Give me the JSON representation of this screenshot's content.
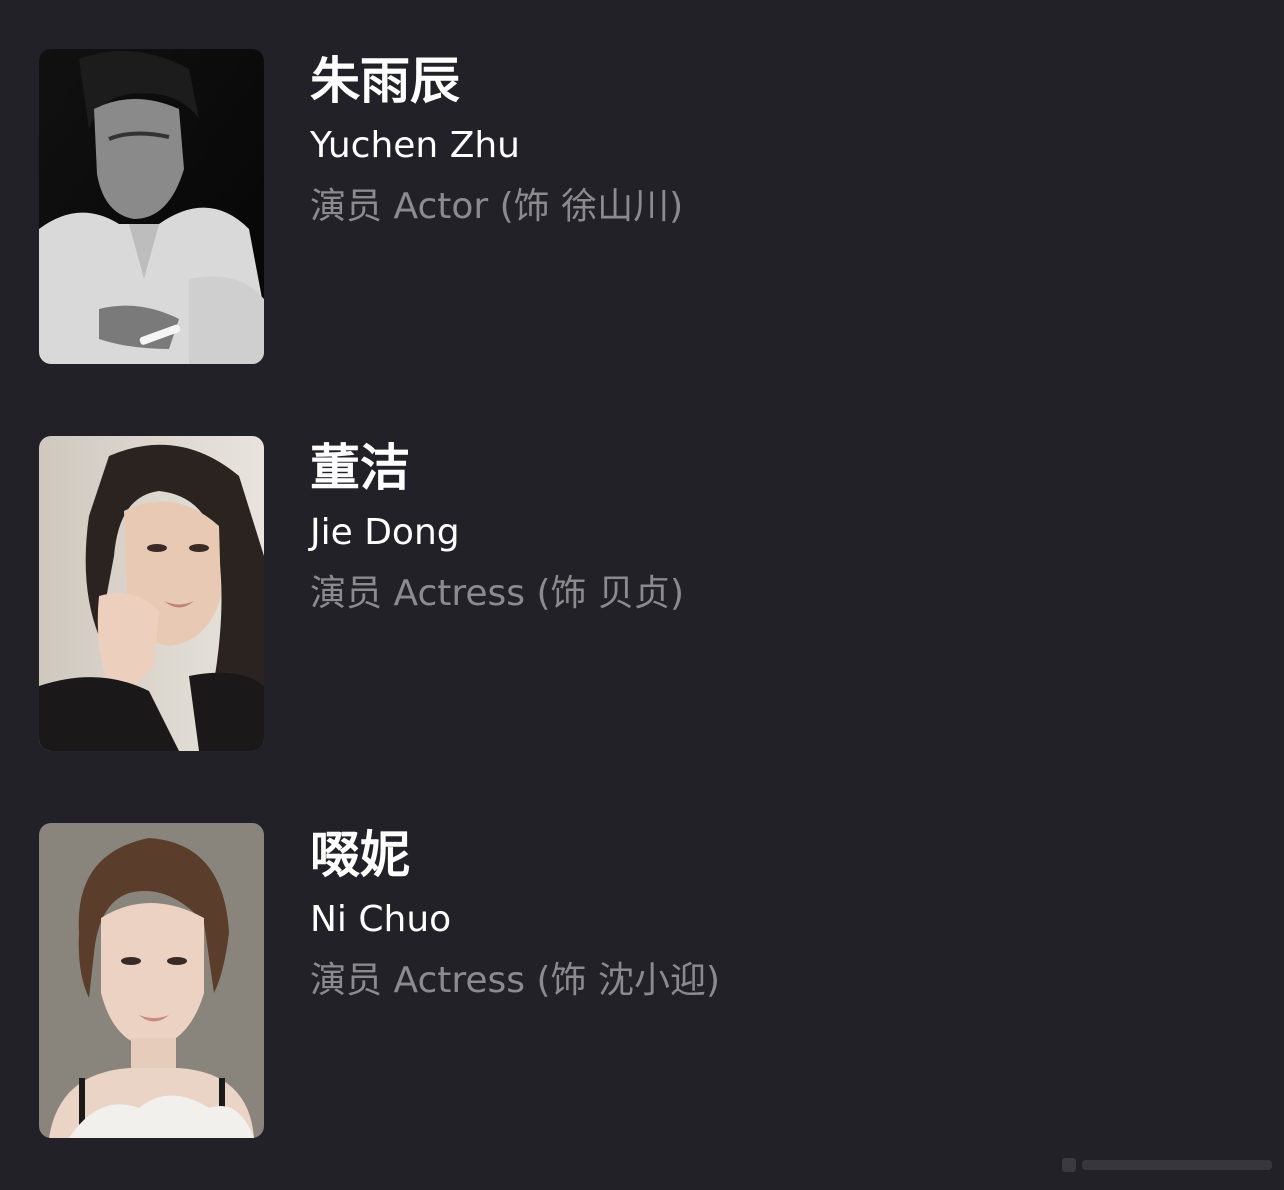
{
  "cast": [
    {
      "name_cn": "朱雨辰",
      "name_en": "Yuchen Zhu",
      "role": "演员 Actor (饰 徐山川)",
      "photo": "portrait-photo-man-black-and-white"
    },
    {
      "name_cn": "董洁",
      "name_en": "Jie Dong",
      "role": "演员 Actress (饰 贝贞)",
      "photo": "portrait-photo-woman-dark-hair"
    },
    {
      "name_cn": "啜妮",
      "name_en": "Ni Chuo",
      "role": "演员 Actress (饰 沈小迎)",
      "photo": "portrait-photo-woman-short-hair"
    }
  ],
  "colors": {
    "background": "#222127",
    "name": "#ffffff",
    "role": "#8b8a8f"
  }
}
